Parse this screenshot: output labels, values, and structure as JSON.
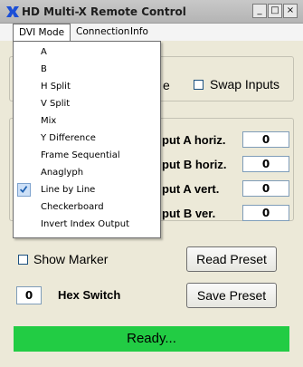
{
  "window": {
    "title": "HD Multi-X Remote Control",
    "minimize_glyph": "_",
    "maximize_glyph": "□",
    "close_glyph": "×"
  },
  "menubar": {
    "items": [
      {
        "label": "DVI Mode",
        "active": true
      },
      {
        "label": "Connection",
        "active": false
      },
      {
        "label": "Info",
        "active": false
      }
    ]
  },
  "dvi_mode_menu": {
    "items": [
      {
        "label": "A",
        "checked": false
      },
      {
        "label": "B",
        "checked": false
      },
      {
        "label": "H Split",
        "checked": false
      },
      {
        "label": "V Split",
        "checked": false
      },
      {
        "label": "Mix",
        "checked": false
      },
      {
        "label": "Y Difference",
        "checked": false
      },
      {
        "label": "Frame Sequential",
        "checked": false
      },
      {
        "label": "Anaglyph",
        "checked": false
      },
      {
        "label": "Line by Line",
        "checked": true
      },
      {
        "label": "Checkerboard",
        "checked": false
      },
      {
        "label": "Invert Index Output",
        "checked": false
      }
    ]
  },
  "mode_group": {
    "partial_label": "e",
    "swap_inputs_label": "Swap Inputs",
    "swap_inputs_checked": false
  },
  "offsets": {
    "rows": [
      {
        "label": "put A horiz.",
        "value": "0"
      },
      {
        "label": "put B horiz.",
        "value": "0"
      },
      {
        "label": "put A vert.",
        "value": "0"
      },
      {
        "label": "put B ver.",
        "value": "0"
      }
    ]
  },
  "controls": {
    "show_marker_label": "Show Marker",
    "show_marker_checked": false,
    "read_preset_label": "Read Preset",
    "hex_switch_value": "0",
    "hex_switch_label": "Hex Switch",
    "save_preset_label": "Save Preset"
  },
  "status": {
    "text": "Ready...",
    "color": "#22cc44"
  },
  "colors": {
    "window_bg": "#ece9d8",
    "checked_item_bg": "#cde0f7",
    "check_mark": "#1c5fb0"
  }
}
